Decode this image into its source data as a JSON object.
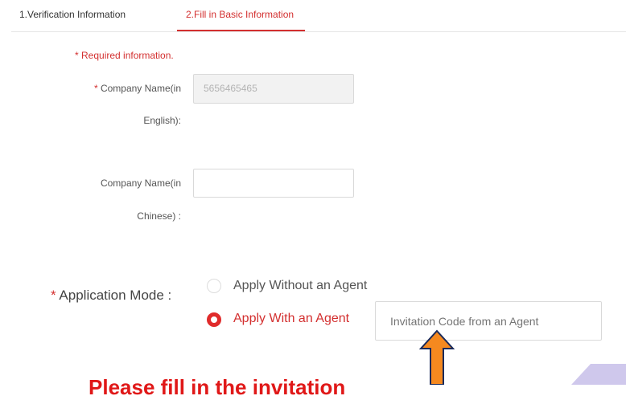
{
  "tabs": [
    {
      "label": "1.Verification Information",
      "active": false
    },
    {
      "label": "2.Fill in Basic Information",
      "active": true
    }
  ],
  "form": {
    "required_note": "* Required information.",
    "company_name_en": {
      "required_mark": "*",
      "label_line1": "Company Name(in",
      "label_line2": "English):",
      "value": "5656465465",
      "disabled": true
    },
    "company_name_cn": {
      "label_line1": "Company Name(in",
      "label_line2": "Chinese) :",
      "value": ""
    },
    "application_mode": {
      "required_mark": "*",
      "label": "Application Mode :",
      "options": [
        {
          "label": "Apply Without an Agent",
          "selected": false
        },
        {
          "label": "Apply With an Agent",
          "selected": true
        }
      ],
      "invitation_placeholder": "Invitation Code from an Agent"
    }
  },
  "annotation": {
    "text": "Please fill in the invitation",
    "arrow_color": "#f5891f",
    "text_color": "#e01818"
  },
  "colors": {
    "accent": "#d32f2f",
    "decor": "#cfc8ec"
  }
}
